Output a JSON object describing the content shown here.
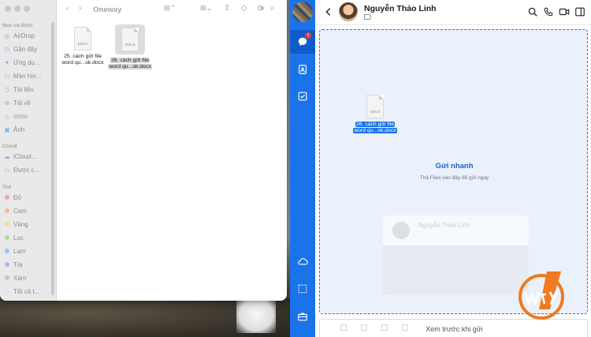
{
  "finder": {
    "title": "Oneway",
    "sections": {
      "favorites": "Mục ưa thích",
      "icloud": "iCloud",
      "tags": "Thẻ"
    },
    "favorites": [
      {
        "label": "AirDrop",
        "icon": "airdrop-icon"
      },
      {
        "label": "Gần đây",
        "icon": "clock-icon"
      },
      {
        "label": "Ứng dụ...",
        "icon": "applications-icon"
      },
      {
        "label": "Màn hìn...",
        "icon": "desktop-icon"
      },
      {
        "label": "Tài liệu",
        "icon": "document-icon"
      },
      {
        "label": "Tải về",
        "icon": "download-icon"
      },
      {
        "label": "",
        "icon": "home-icon"
      },
      {
        "label": "Ảnh",
        "icon": "photos-icon"
      }
    ],
    "icloud": [
      {
        "label": "iCloud...",
        "icon": "cloud-icon"
      },
      {
        "label": "Được c...",
        "icon": "shared-folder-icon"
      }
    ],
    "tags": [
      {
        "label": "Đỏ",
        "color": "#f3a6a6"
      },
      {
        "label": "Cam",
        "color": "#f5c08a"
      },
      {
        "label": "Vàng",
        "color": "#f2dd87"
      },
      {
        "label": "Lục",
        "color": "#a7dba0"
      },
      {
        "label": "Lam",
        "color": "#9ec4f0"
      },
      {
        "label": "Tía",
        "color": "#cfa8e6"
      },
      {
        "label": "Xám",
        "color": "#c4c4c4"
      },
      {
        "label": "Tất cả t...",
        "color": ""
      }
    ],
    "files": [
      {
        "ext": "DOCX",
        "line1": "25. cách gửi file",
        "line2": "word qu...ok.docx"
      },
      {
        "ext": "DOCX",
        "line1": "26. cách gửi file",
        "line2": "word qu...ok.docx"
      }
    ]
  },
  "chat": {
    "contact_name": "Nguyễn Thảo Linh",
    "rail_badge": "1",
    "drop_title": "Gửi nhanh",
    "drop_subtitle": "Thả Files vào đây để gửi ngay",
    "dragged_file": {
      "ext": "DOCX",
      "line1": "26. cách gửi file",
      "line2": "word qu...ok.docx"
    },
    "ghost_name": "Nguyễn Thảo Linh",
    "preview_send": "Xem trước khi gửi"
  },
  "colors": {
    "accent": "#1a73e8",
    "drop_zone": "#eaf1fb",
    "watermark": "#f07a1f"
  }
}
